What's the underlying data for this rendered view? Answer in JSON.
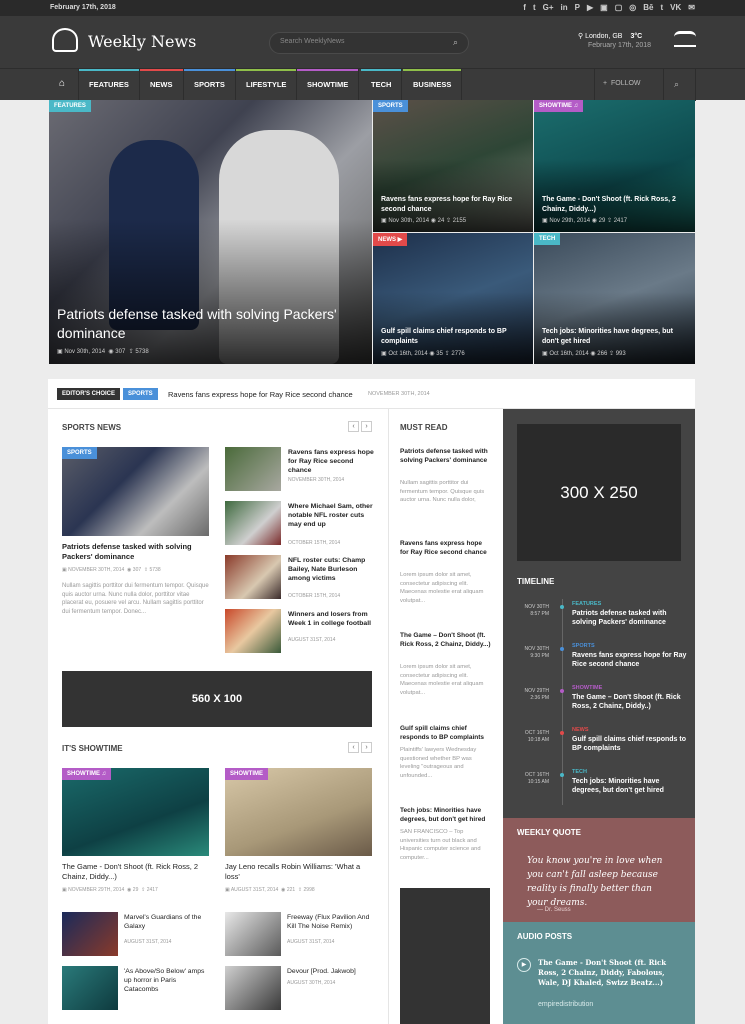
{
  "topbar": {
    "date": "February 17th, 2018",
    "social": [
      "f",
      "t",
      "G+",
      "in",
      "P",
      "▶",
      "▣",
      "▢",
      "◎",
      "Bē",
      "t",
      "VK",
      "✉"
    ]
  },
  "header": {
    "site_name": "Weekly News",
    "search_placeholder": "Search WeeklyNews",
    "location": "London, GB",
    "temperature": "3°C",
    "weather_date": "February 17th, 2018"
  },
  "nav": {
    "home_icon": "home-icon",
    "items": [
      {
        "label": "FEATURES",
        "color": "#4ab8c7"
      },
      {
        "label": "NEWS",
        "color": "#e24a4a"
      },
      {
        "label": "SPORTS",
        "color": "#4a90d9"
      },
      {
        "label": "LIFESTYLE",
        "color": "#8fbf4a"
      },
      {
        "label": "SHOWTIME",
        "color": "#b45cc7"
      },
      {
        "label": "TECH",
        "color": "#4ab8c7"
      },
      {
        "label": "BUSINESS",
        "color": "#8fbf4a"
      }
    ],
    "follow": "FOLLOW",
    "follow_icon": "+"
  },
  "hero": {
    "main": {
      "tag": "FEATURES",
      "tag_color": "#4ab8c7",
      "title": "Patriots defense tasked with solving Packers' dominance",
      "date": "Nov 30th, 2014",
      "views": "307",
      "shares": "5738"
    },
    "tiles": [
      {
        "tag": "SPORTS",
        "tag_color": "#4a90d9",
        "title": "Ravens fans express hope for Ray Rice second chance",
        "date": "Nov 30th, 2014",
        "views": "24",
        "shares": "2155"
      },
      {
        "tag": "SHOWTIME",
        "tag_color": "#b45cc7",
        "title": "The Game - Don't Shoot (ft. Rick Ross, 2 Chainz, Diddy...)",
        "date": "Nov 29th, 2014",
        "views": "29",
        "shares": "2417"
      },
      {
        "tag": "NEWS",
        "tag_color": "#e24a4a",
        "title": "Gulf spill claims chief responds to BP complaints",
        "date": "Oct 16th, 2014",
        "views": "35",
        "shares": "2776"
      },
      {
        "tag": "TECH",
        "tag_color": "#4ab8c7",
        "title": "Tech jobs: Minorities have degrees, but don't get hired",
        "date": "Oct 16th, 2014",
        "views": "266",
        "shares": "993"
      }
    ]
  },
  "ticker": {
    "label": "EDITOR'S CHOICE",
    "tag": "SPORTS",
    "title": "Ravens fans express hope for Ray Rice second chance",
    "date": "NOVEMBER 30TH, 2014"
  },
  "sports": {
    "heading": "SPORTS NEWS",
    "main": {
      "tag": "SPORTS",
      "title": "Patriots defense tasked with solving Packers' dominance",
      "date": "NOVEMBER 30TH, 2014",
      "views": "307",
      "shares": "5738",
      "excerpt": "Nullam sagittis porttitor dui fermentum tempor. Quisque quis auctor urna. Nunc nulla dolor, porttitor vitae placerat eu, posuere vel arcu. Nullam sagittis porttitor dui fermentum tempor. Donec..."
    },
    "list": [
      {
        "title": "Ravens fans express hope for Ray Rice second chance",
        "date": "NOVEMBER 30TH, 2014"
      },
      {
        "title": "Where Michael Sam, other notable NFL roster cuts may end up",
        "date": "OCTOBER 15TH, 2014"
      },
      {
        "title": "NFL roster cuts: Champ Bailey, Nate Burleson among victims",
        "date": "OCTOBER 15TH, 2014"
      },
      {
        "title": "Winners and losers from Week 1 in college football",
        "date": "AUGUST 31ST, 2014"
      }
    ]
  },
  "ad_mid": "560 X 100",
  "showtime": {
    "heading": "IT'S SHOWTIME",
    "cards": [
      {
        "tag": "SHOWTIME",
        "title": "The Game - Don't Shoot (ft. Rick Ross, 2 Chainz, Diddy...)",
        "date": "NOVEMBER 29TH, 2014",
        "views": "29",
        "shares": "2417"
      },
      {
        "tag": "SHOWTIME",
        "title": "Jay Leno recalls Robin Williams: 'What a loss'",
        "date": "AUGUST 31ST, 2014",
        "views": "221",
        "shares": "2998"
      }
    ],
    "list": [
      {
        "title": "Marvel's Guardians of the Galaxy",
        "date": "AUGUST 31ST, 2014"
      },
      {
        "title": "Freeway (Flux Pavilion And Kill The Noise Remix)",
        "date": "AUGUST 31ST, 2014"
      },
      {
        "title": "'As Above/So Below' amps up horror in Paris Catacombs",
        "date": "AUGUST 31ST, 2014"
      },
      {
        "title": "Devour [Prod. Jakwob]",
        "date": "AUGUST 30TH, 2014"
      }
    ]
  },
  "must_read": {
    "heading": "MUST READ",
    "items": [
      {
        "title": "Patriots defense tasked with solving Packers' dominance",
        "excerpt": "Nullam sagittis porttitor dui fermentum tempor. Quisque quis auctor urna. Nunc nulla dolor,"
      },
      {
        "title": "Ravens fans express hope for Ray Rice second chance",
        "excerpt": "Lorem ipsum dolor sit amet, consectetur adipiscing elit. Maecenas molestie erat aliquam volutpat..."
      },
      {
        "title": "The Game – Don't Shoot (ft. Rick Ross, 2 Chainz, Diddy...)",
        "excerpt": "Lorem ipsum dolor sit amet, consectetur adipiscing elit. Maecenas molestie erat aliquam volutpat..."
      },
      {
        "title": "Gulf spill claims chief responds to BP complaints",
        "excerpt": "Plaintiffs' lawyers Wednesday questioned whether BP was leveling \"outrageous and unfounded..."
      },
      {
        "title": "Tech jobs: Minorities have degrees, but don't get hired",
        "excerpt": "SAN FRANCISCO – Top universities turn out black and Hispanic computer science and computer..."
      }
    ]
  },
  "sidebar": {
    "ad": "300 X 250",
    "timeline_heading": "TIMELINE",
    "timeline": [
      {
        "date": "NOV 30TH",
        "time": "8:57 PM",
        "cat": "FEATURES",
        "color": "#4ab8c7",
        "title": "Patriots defense tasked with solving Packers' dominance"
      },
      {
        "date": "NOV 30TH",
        "time": "9:30 PM",
        "cat": "SPORTS",
        "color": "#4a90d9",
        "title": "Ravens fans express hope for Ray Rice second chance"
      },
      {
        "date": "NOV 29TH",
        "time": "2:36 PM",
        "cat": "SHOWTIME",
        "color": "#b45cc7",
        "title": "The Game – Don't Shoot (ft. Rick Ross, 2 Chainz, Diddy..)"
      },
      {
        "date": "OCT 16TH",
        "time": "10:18 AM",
        "cat": "NEWS",
        "color": "#e24a4a",
        "title": "Gulf spill claims chief responds to BP complaints"
      },
      {
        "date": "OCT 16TH",
        "time": "10:15 AM",
        "cat": "TECH",
        "color": "#4ab8c7",
        "title": "Tech jobs: Minorities have degrees, but don't get hired"
      }
    ],
    "quote_heading": "WEEKLY QUOTE",
    "quote": "You know you're in love when you can't fall asleep because reality is finally better than your dreams.",
    "quote_author": "— Dr. Seuss",
    "audio_heading": "AUDIO POSTS",
    "audio_title": "The Game - Don't Shoot (ft. Rick Ross, 2 Chainz, Diddy, Fabolous, Wale, DJ Khaled, Swizz Beatz...)",
    "audio_source": "empiredistribution"
  }
}
